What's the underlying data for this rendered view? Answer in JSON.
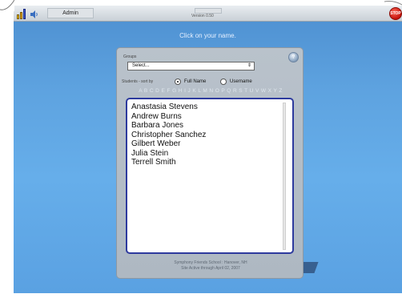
{
  "topbar": {
    "user_label": "Admin",
    "version_label": "Version 0.50",
    "stop_label": "STOP"
  },
  "instruction": "Click on your name.",
  "groups": {
    "label": "Groups",
    "select_value": "Select..."
  },
  "sort": {
    "label": "Students - sort by",
    "options": [
      {
        "label": "Full Name",
        "selected": true
      },
      {
        "label": "Username",
        "selected": false
      }
    ]
  },
  "letters": [
    "A",
    "B",
    "C",
    "D",
    "E",
    "F",
    "G",
    "H",
    "I",
    "J",
    "K",
    "L",
    "M",
    "N",
    "O",
    "P",
    "Q",
    "R",
    "S",
    "T",
    "U",
    "V",
    "W",
    "X",
    "Y",
    "Z"
  ],
  "students": [
    "Anastasia Stevens",
    "Andrew Burns",
    "Barbara Jones",
    "Christopher Sanchez",
    "Gilbert Weber",
    "Julia Stein",
    "Terrell Smith"
  ],
  "footer": {
    "line1": "Symphony Friends School : Hanover, NH",
    "line2": "Site Active through April 02, 2007"
  },
  "icons": {
    "signal": "signal-bars-icon",
    "speaker": "speaker-icon",
    "help": "help-icon"
  },
  "colors": {
    "background": "#5ea3e0",
    "list_border": "#2d3a9e",
    "stop": "#c4120a"
  }
}
